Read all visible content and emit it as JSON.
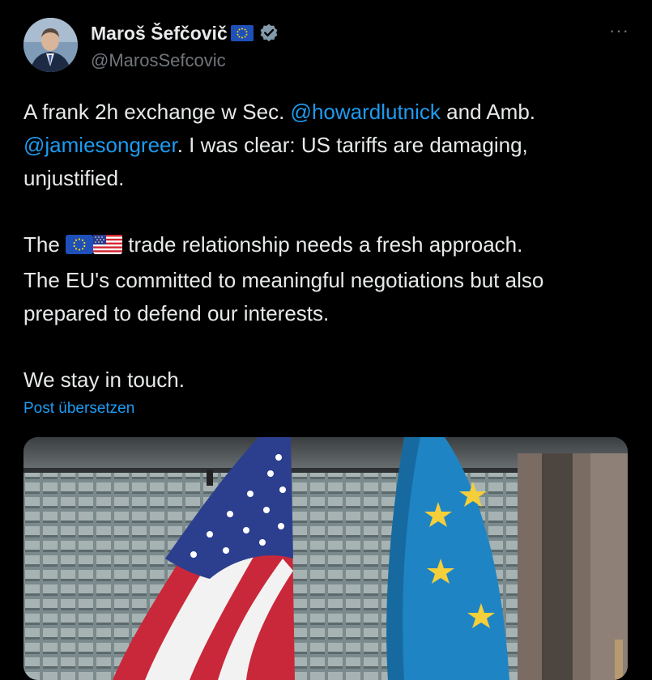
{
  "author": {
    "display_name": "Maroš Šefčovič",
    "handle": "@MarosSefcovic",
    "badge_icon": "eu-flag-icon",
    "verified_icon": "verified-badge-icon"
  },
  "more_button": "···",
  "tweet": {
    "line1_prefix": "A frank 2h exchange w Sec. ",
    "mention1": "@howardlutnick",
    "line1_suffix": " and Amb.",
    "mention2": "@jamiesongreer",
    "line2_suffix": ". I was clear: US tariffs are damaging,",
    "line3": "unjustified.",
    "para2_prefix": "The ",
    "para2_flags": [
      "eu-flag-icon",
      "us-flag-icon"
    ],
    "para2_suffix": " trade relationship needs a fresh approach.",
    "para2_line2": "The EU's committed to meaningful negotiations but also",
    "para2_line3": "prepared to defend our interests.",
    "para3": "We stay in touch."
  },
  "translate_link": "Post übersetzen",
  "colors": {
    "background": "#000000",
    "text": "#e7e9ea",
    "muted": "#71767b",
    "link": "#1d9bf0"
  },
  "media": {
    "subject": "photo of US and EU flags in front of a building"
  }
}
